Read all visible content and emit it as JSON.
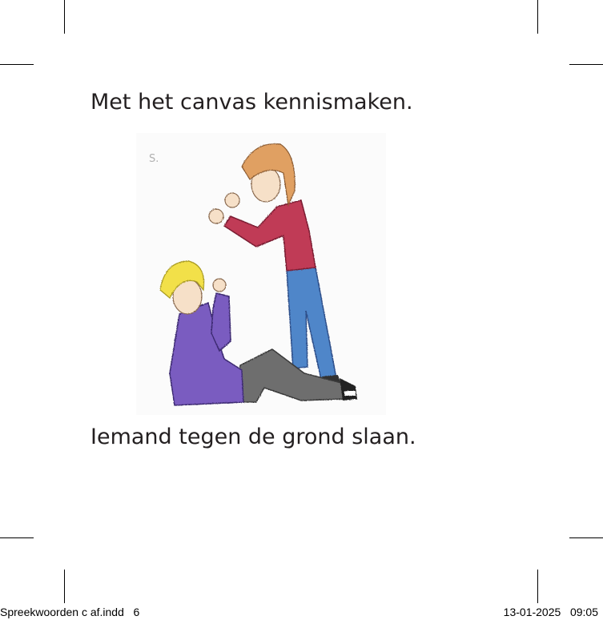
{
  "page": {
    "caption_top": "Met het canvas kennismaken.",
    "caption_bottom": "Iemand tegen de grond slaan.",
    "illustration_mark": "S."
  },
  "slug": {
    "file": "Spreekwoorden c af.indd   6",
    "timestamp": "13-01-2025   09:05"
  }
}
